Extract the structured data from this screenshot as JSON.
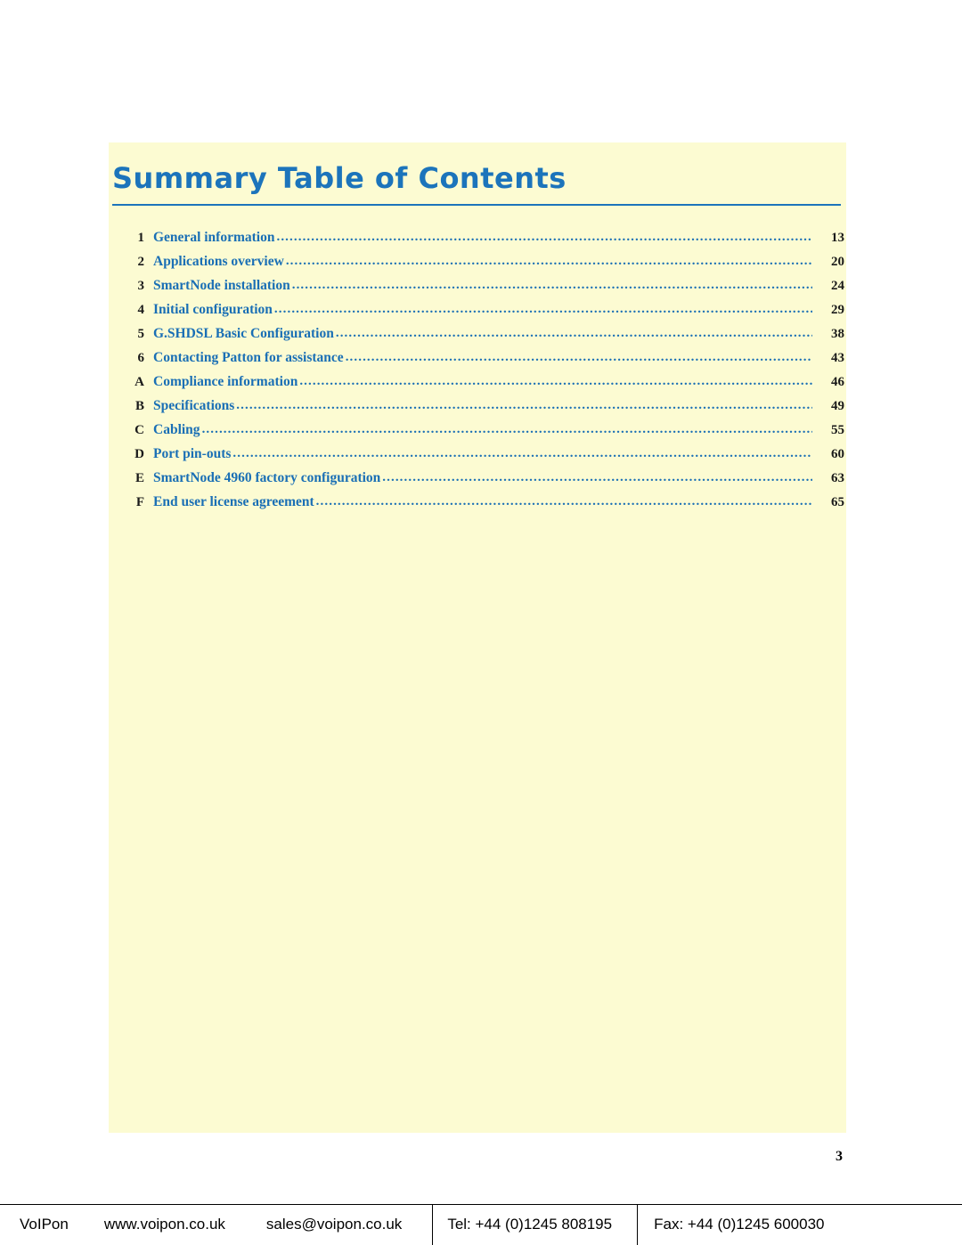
{
  "document": {
    "title": "Summary Table of Contents",
    "page_number": "3"
  },
  "toc": {
    "entries": [
      {
        "num": "1",
        "label": "General information",
        "page": "13"
      },
      {
        "num": "2",
        "label": "Applications overview",
        "page": "20"
      },
      {
        "num": "3",
        "label": "SmartNode installation",
        "page": "24"
      },
      {
        "num": "4",
        "label": "Initial configuration",
        "page": "29"
      },
      {
        "num": "5",
        "label": "G.SHDSL Basic Configuration",
        "page": "38"
      },
      {
        "num": "6",
        "label": "Contacting Patton for assistance",
        "page": "43"
      },
      {
        "num": "A",
        "label": "Compliance information",
        "page": "46"
      },
      {
        "num": "B",
        "label": "Specifications",
        "page": "49"
      },
      {
        "num": "C",
        "label": "Cabling",
        "page": "55"
      },
      {
        "num": "D",
        "label": "Port pin-outs",
        "page": "60"
      },
      {
        "num": "E",
        "label": "SmartNode 4960 factory configuration",
        "page": "63"
      },
      {
        "num": "F",
        "label": "End user license agreement",
        "page": "65"
      }
    ]
  },
  "footer": {
    "brand": "VoIPon",
    "website": "www.voipon.co.uk",
    "email": "sales@voipon.co.uk",
    "telephone": "Tel: +44 (0)1245 808195",
    "fax": "Fax: +44 (0)1245 600030"
  },
  "colors": {
    "accent": "#1c74bb",
    "panel": "#fcfbd2",
    "text": "#1a1a1a"
  }
}
